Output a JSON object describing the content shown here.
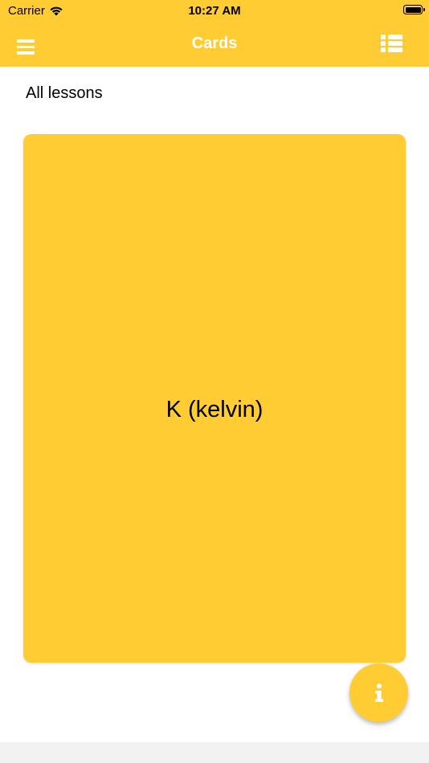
{
  "status_bar": {
    "carrier": "Carrier",
    "time": "10:27 AM",
    "wifi_icon": "wifi-icon",
    "battery_icon": "battery-icon"
  },
  "nav": {
    "title": "Cards",
    "left_icon": "hamburger-menu-icon",
    "right_icon": "list-icon"
  },
  "lesson": {
    "label": "All lessons"
  },
  "card": {
    "text": "K (kelvin)"
  },
  "fab": {
    "icon": "info-icon"
  },
  "colors": {
    "accent": "#FFCC33",
    "nav_text": "#FFFFFF",
    "bottom_bar": "#F2F2F2"
  }
}
